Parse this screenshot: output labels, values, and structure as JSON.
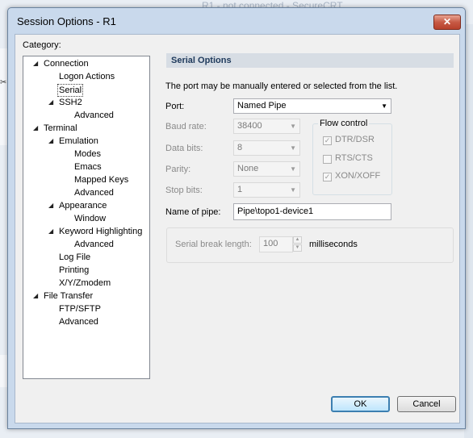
{
  "background": {
    "title": "R1 - not connected - SecureCRT"
  },
  "dialog": {
    "title": "Session Options - R1",
    "close_glyph": "✕",
    "category_label": "Category:"
  },
  "tree": [
    {
      "label": "Connection",
      "expanded": true
    },
    {
      "label": "Logon Actions"
    },
    {
      "label": "Serial",
      "selected": true
    },
    {
      "label": "SSH2",
      "expanded": true
    },
    {
      "label": "Advanced"
    },
    {
      "label": "Terminal",
      "expanded": true
    },
    {
      "label": "Emulation",
      "expanded": true
    },
    {
      "label": "Modes"
    },
    {
      "label": "Emacs"
    },
    {
      "label": "Mapped Keys"
    },
    {
      "label": "Advanced"
    },
    {
      "label": "Appearance",
      "expanded": true
    },
    {
      "label": "Window"
    },
    {
      "label": "Keyword Highlighting",
      "expanded": true
    },
    {
      "label": "Advanced"
    },
    {
      "label": "Log File"
    },
    {
      "label": "Printing"
    },
    {
      "label": "X/Y/Zmodem"
    },
    {
      "label": "File Transfer",
      "expanded": true
    },
    {
      "label": "FTP/SFTP"
    },
    {
      "label": "Advanced"
    }
  ],
  "panel": {
    "header": "Serial Options",
    "intro": "The port may be manually entered or selected from the list.",
    "port_label": "Port:",
    "port_value": "Named Pipe",
    "baud_label": "Baud rate:",
    "baud_value": "38400",
    "databits_label": "Data bits:",
    "databits_value": "8",
    "parity_label": "Parity:",
    "parity_value": "None",
    "stopbits_label": "Stop bits:",
    "stopbits_value": "1",
    "pipe_label": "Name of pipe:",
    "pipe_value": "Pipe\\topo1-device1",
    "flow_title": "Flow control",
    "flow": [
      {
        "label": "DTR/DSR",
        "checked": true
      },
      {
        "label": "RTS/CTS",
        "checked": false
      },
      {
        "label": "XON/XOFF",
        "checked": true
      }
    ],
    "break_label": "Serial break length:",
    "break_value": "100",
    "break_unit": "milliseconds"
  },
  "buttons": {
    "ok": "OK",
    "cancel": "Cancel"
  }
}
